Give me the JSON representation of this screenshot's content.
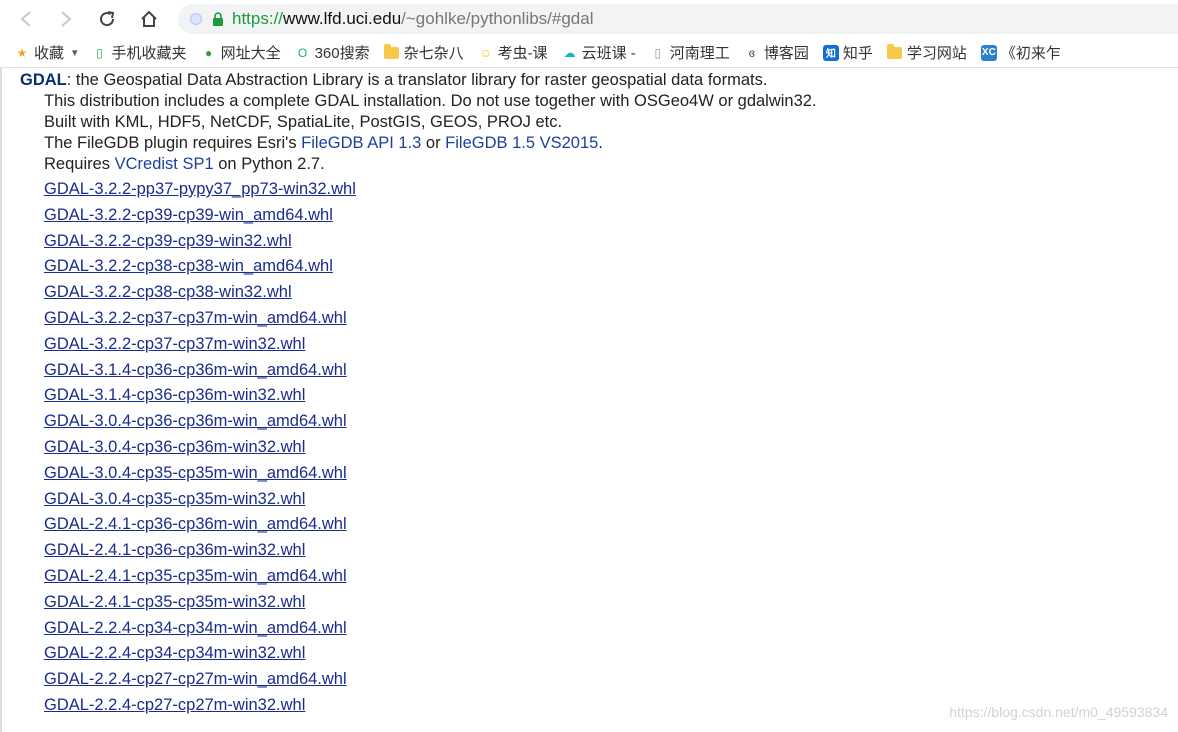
{
  "browser": {
    "url_scheme": "https://",
    "url_host": "www.lfd.uci.edu",
    "url_path": "/~gohlke/pythonlibs/#gdal",
    "nav": {
      "back_icon": "back-arrow-icon",
      "forward_icon": "forward-arrow-icon",
      "reload_icon": "reload-icon",
      "home_icon": "home-icon"
    }
  },
  "bookmarks": [
    {
      "label": "收藏",
      "icon": "star-icon",
      "color": "#f5a623"
    },
    {
      "label": "手机收藏夹",
      "icon": "phone-icon",
      "color": "#2bb24c"
    },
    {
      "label": "网址大全",
      "icon": "globe-icon",
      "color": "#3aa336"
    },
    {
      "label": "360搜索",
      "icon": "search-o-icon",
      "color": "#1db15c"
    },
    {
      "label": "杂七杂八",
      "icon": "folder-icon",
      "color": "#f7c84a"
    },
    {
      "label": "考虫-课",
      "icon": "smiley-icon",
      "color": "#f5c518"
    },
    {
      "label": "云班课 -",
      "icon": "cloud-icon",
      "color": "#14b3c9"
    },
    {
      "label": "河南理工",
      "icon": "page-icon",
      "color": "#999999"
    },
    {
      "label": "博客园",
      "icon": "blog-icon",
      "color": "#444444"
    },
    {
      "label": "知乎",
      "icon": "zhihu-icon",
      "color": "#0f6fd6"
    },
    {
      "label": "学习网站",
      "icon": "folder-icon",
      "color": "#f7c84a"
    },
    {
      "label": "《初来乍",
      "icon": "xc-icon",
      "color": "#2a7fd0"
    }
  ],
  "page": {
    "lead_name": "GDAL",
    "lead_text": ": the Geospatial Data Abstraction Library is a translator library for raster geospatial data formats.",
    "line1": "This distribution includes a complete GDAL installation. Do not use together with OSGeo4W or gdalwin32.",
    "line2": "Built with KML, HDF5, NetCDF, SpatiaLite, PostGIS, GEOS, PROJ etc.",
    "line3_pre": "The FileGDB plugin requires Esri's ",
    "line3_link1": "FileGDB API 1.3",
    "line3_mid": " or ",
    "line3_link2": "FileGDB 1.5 VS2015",
    "line3_post": ".",
    "line4_pre": "Requires ",
    "line4_link": "VCredist SP1",
    "line4_post": " on Python 2.7."
  },
  "files": [
    "GDAL-3.2.2-pp37-pypy37_pp73-win32.whl",
    "GDAL-3.2.2-cp39-cp39-win_amd64.whl",
    "GDAL-3.2.2-cp39-cp39-win32.whl",
    "GDAL-3.2.2-cp38-cp38-win_amd64.whl",
    "GDAL-3.2.2-cp38-cp38-win32.whl",
    "GDAL-3.2.2-cp37-cp37m-win_amd64.whl",
    "GDAL-3.2.2-cp37-cp37m-win32.whl",
    "GDAL-3.1.4-cp36-cp36m-win_amd64.whl",
    "GDAL-3.1.4-cp36-cp36m-win32.whl",
    "GDAL-3.0.4-cp36-cp36m-win_amd64.whl",
    "GDAL-3.0.4-cp36-cp36m-win32.whl",
    "GDAL-3.0.4-cp35-cp35m-win_amd64.whl",
    "GDAL-3.0.4-cp35-cp35m-win32.whl",
    "GDAL-2.4.1-cp36-cp36m-win_amd64.whl",
    "GDAL-2.4.1-cp36-cp36m-win32.whl",
    "GDAL-2.4.1-cp35-cp35m-win_amd64.whl",
    "GDAL-2.4.1-cp35-cp35m-win32.whl",
    "GDAL-2.2.4-cp34-cp34m-win_amd64.whl",
    "GDAL-2.2.4-cp34-cp34m-win32.whl",
    "GDAL-2.2.4-cp27-cp27m-win_amd64.whl",
    "GDAL-2.2.4-cp27-cp27m-win32.whl"
  ],
  "watermark": "https://blog.csdn.net/m0_49593834"
}
